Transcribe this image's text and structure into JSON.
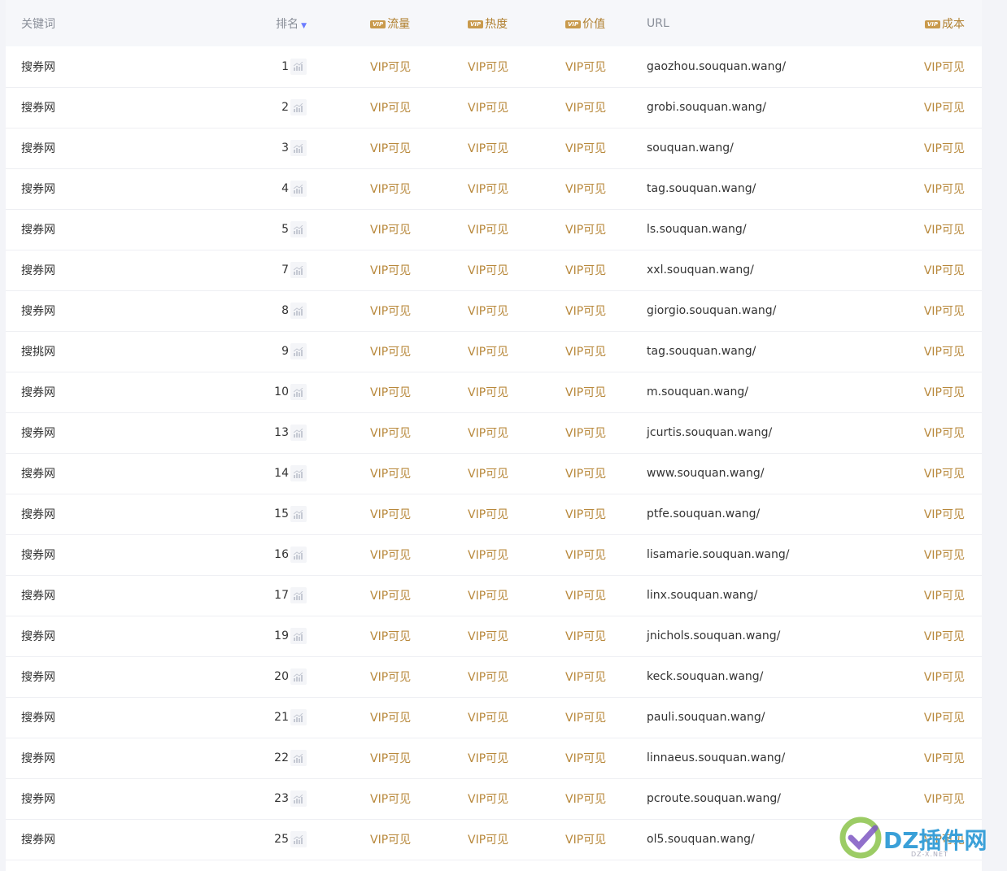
{
  "columns": {
    "keyword": "关键词",
    "rank": "排名",
    "traffic": "流量",
    "heat": "热度",
    "value": "价值",
    "url": "URL",
    "cost": "成本",
    "vip_badge": "VIP"
  },
  "icons": {
    "sort": "sort-down-icon",
    "trend": "bar-chart-icon"
  },
  "colors": {
    "vip_gold": "#b8883b",
    "sort_accent": "#6b7cff"
  },
  "rows": [
    {
      "keyword": "搜券网",
      "rank": "1",
      "traffic": "VIP可见",
      "heat": "VIP可见",
      "value": "VIP可见",
      "url": "gaozhou.souquan.wang/",
      "cost": "VIP可见"
    },
    {
      "keyword": "搜券网",
      "rank": "2",
      "traffic": "VIP可见",
      "heat": "VIP可见",
      "value": "VIP可见",
      "url": "grobi.souquan.wang/",
      "cost": "VIP可见"
    },
    {
      "keyword": "搜券网",
      "rank": "3",
      "traffic": "VIP可见",
      "heat": "VIP可见",
      "value": "VIP可见",
      "url": "souquan.wang/",
      "cost": "VIP可见"
    },
    {
      "keyword": "搜券网",
      "rank": "4",
      "traffic": "VIP可见",
      "heat": "VIP可见",
      "value": "VIP可见",
      "url": "tag.souquan.wang/",
      "cost": "VIP可见"
    },
    {
      "keyword": "搜券网",
      "rank": "5",
      "traffic": "VIP可见",
      "heat": "VIP可见",
      "value": "VIP可见",
      "url": "ls.souquan.wang/",
      "cost": "VIP可见"
    },
    {
      "keyword": "搜券网",
      "rank": "7",
      "traffic": "VIP可见",
      "heat": "VIP可见",
      "value": "VIP可见",
      "url": "xxl.souquan.wang/",
      "cost": "VIP可见"
    },
    {
      "keyword": "搜券网",
      "rank": "8",
      "traffic": "VIP可见",
      "heat": "VIP可见",
      "value": "VIP可见",
      "url": "giorgio.souquan.wang/",
      "cost": "VIP可见"
    },
    {
      "keyword": "搜挑网",
      "rank": "9",
      "traffic": "VIP可见",
      "heat": "VIP可见",
      "value": "VIP可见",
      "url": "tag.souquan.wang/",
      "cost": "VIP可见"
    },
    {
      "keyword": "搜券网",
      "rank": "10",
      "traffic": "VIP可见",
      "heat": "VIP可见",
      "value": "VIP可见",
      "url": "m.souquan.wang/",
      "cost": "VIP可见"
    },
    {
      "keyword": "搜券网",
      "rank": "13",
      "traffic": "VIP可见",
      "heat": "VIP可见",
      "value": "VIP可见",
      "url": "jcurtis.souquan.wang/",
      "cost": "VIP可见"
    },
    {
      "keyword": "搜券网",
      "rank": "14",
      "traffic": "VIP可见",
      "heat": "VIP可见",
      "value": "VIP可见",
      "url": "www.souquan.wang/",
      "cost": "VIP可见"
    },
    {
      "keyword": "搜券网",
      "rank": "15",
      "traffic": "VIP可见",
      "heat": "VIP可见",
      "value": "VIP可见",
      "url": "ptfe.souquan.wang/",
      "cost": "VIP可见"
    },
    {
      "keyword": "搜券网",
      "rank": "16",
      "traffic": "VIP可见",
      "heat": "VIP可见",
      "value": "VIP可见",
      "url": "lisamarie.souquan.wang/",
      "cost": "VIP可见"
    },
    {
      "keyword": "搜券网",
      "rank": "17",
      "traffic": "VIP可见",
      "heat": "VIP可见",
      "value": "VIP可见",
      "url": "linx.souquan.wang/",
      "cost": "VIP可见"
    },
    {
      "keyword": "搜券网",
      "rank": "19",
      "traffic": "VIP可见",
      "heat": "VIP可见",
      "value": "VIP可见",
      "url": "jnichols.souquan.wang/",
      "cost": "VIP可见"
    },
    {
      "keyword": "搜券网",
      "rank": "20",
      "traffic": "VIP可见",
      "heat": "VIP可见",
      "value": "VIP可见",
      "url": "keck.souquan.wang/",
      "cost": "VIP可见"
    },
    {
      "keyword": "搜券网",
      "rank": "21",
      "traffic": "VIP可见",
      "heat": "VIP可见",
      "value": "VIP可见",
      "url": "pauli.souquan.wang/",
      "cost": "VIP可见"
    },
    {
      "keyword": "搜券网",
      "rank": "22",
      "traffic": "VIP可见",
      "heat": "VIP可见",
      "value": "VIP可见",
      "url": "linnaeus.souquan.wang/",
      "cost": "VIP可见"
    },
    {
      "keyword": "搜券网",
      "rank": "23",
      "traffic": "VIP可见",
      "heat": "VIP可见",
      "value": "VIP可见",
      "url": "pcroute.souquan.wang/",
      "cost": "VIP可见"
    },
    {
      "keyword": "搜券网",
      "rank": "25",
      "traffic": "VIP可见",
      "heat": "VIP可见",
      "value": "VIP可见",
      "url": "ol5.souquan.wang/",
      "cost": "VIP可见"
    }
  ],
  "watermark": {
    "main": "DZ插件网",
    "sub": "DZ-X.NET"
  }
}
